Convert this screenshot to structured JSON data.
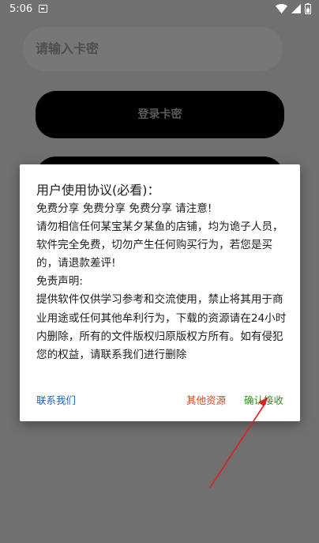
{
  "status_bar": {
    "time": "5:06",
    "icons": [
      "photo-icon",
      "wifi-icon",
      "signal-icon",
      "battery-icon"
    ]
  },
  "background_screen": {
    "cardkey_placeholder": "请输入卡密",
    "login_button_label": "登录卡密"
  },
  "dialog": {
    "title": "用户使用协议(必看)：",
    "paragraphs": [
      "免费分享 免费分享 免费分享 请注意!",
      "请勿相信任何某宝某夕某鱼的店铺，均为诡子人员，软件完全免费，切勿产生任何购买行为，若您是买的，请退款差评!",
      "免责声明:",
      "提供软件仅供学习参考和交流使用，禁止将其用于商业用途或任何其他牟利行为，下载的资源请在24小时内删除，所有的文件版权归原版权方所有。如有侵犯您的权益，请联系我们进行删除"
    ],
    "buttons": {
      "contact": "联系我们",
      "other": "其他资源",
      "confirm": "确认接收"
    }
  },
  "colors": {
    "contact_button": "#1e63b4",
    "other_button": "#d2451e",
    "confirm_button": "#3a8a2a",
    "annotation_arrow": "#e02020"
  }
}
